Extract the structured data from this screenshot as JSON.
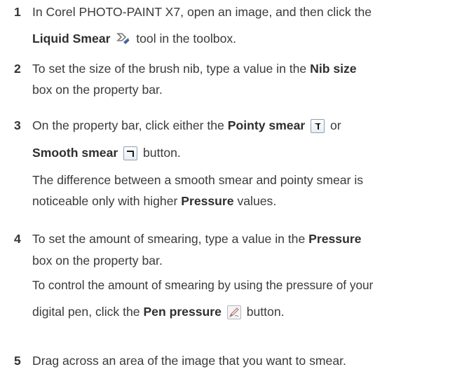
{
  "steps": [
    {
      "num": "1",
      "l1": "In Corel PHOTO-PAINT X7, open an image, and then click the",
      "l2_bold": "Liquid Smear",
      "l2_rest": "tool in the toolbox.",
      "icon": "liquid-smear-icon"
    },
    {
      "num": "2",
      "l1_pre": "To set the size of the brush nib, type a value in the",
      "l1_bold": "Nib size",
      "l2": "box on the property bar."
    },
    {
      "num": "3",
      "l1_pre": "On the property bar, click either the",
      "l1_bold": "Pointy smear",
      "l1_or": "or",
      "l2_bold": "Smooth smear",
      "l2_rest": "button.",
      "note_l1": "The difference between a smooth smear and pointy smear is",
      "note_l2_pre": "noticeable only with higher",
      "note_l2_bold": "Pressure",
      "note_l2_rest": "values.",
      "icons": [
        "pointy-smear-icon",
        "smooth-smear-icon"
      ]
    },
    {
      "num": "4",
      "l1_pre": "To set the amount of smearing, type a value in the",
      "l1_bold": "Pressure",
      "l2": "box on the property bar.",
      "note_l1": "To control the amount of smearing by using the pressure of your",
      "note_l2_pre": "digital pen, click the",
      "note_l2_bold": "Pen pressure",
      "note_l2_rest": "button.",
      "icon": "pen-pressure-icon"
    },
    {
      "num": "5",
      "l1": "Drag across an area of the image that you want to smear."
    }
  ]
}
